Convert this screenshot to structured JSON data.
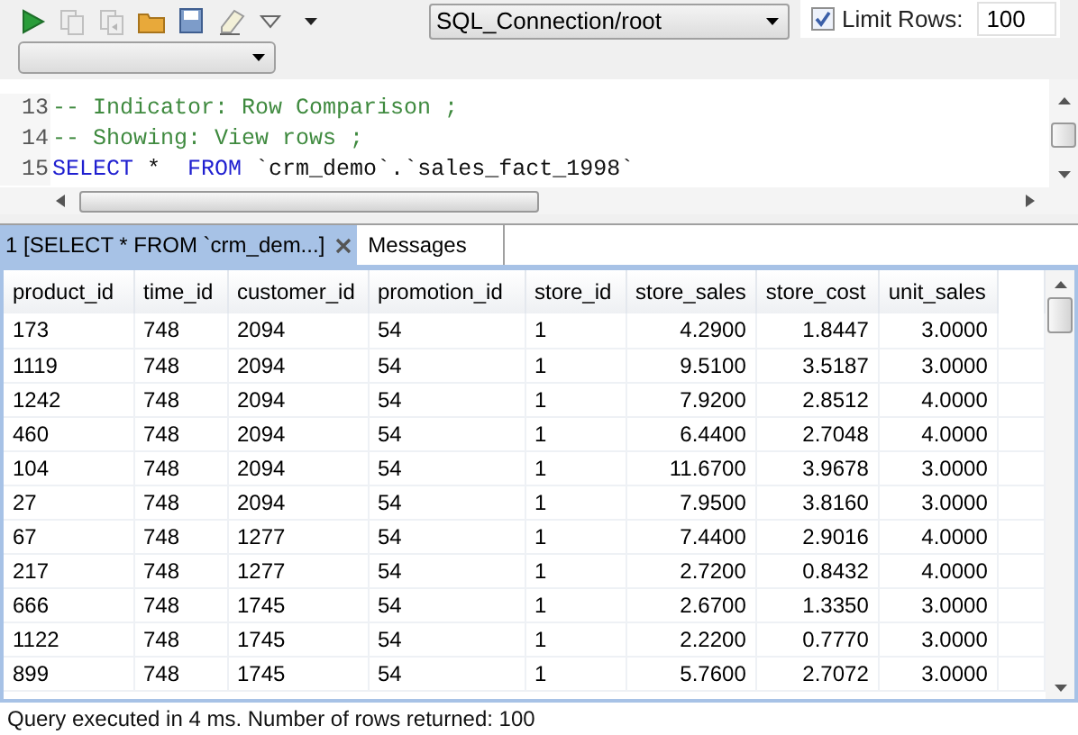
{
  "toolbar": {
    "buttons": [
      {
        "kind": "run",
        "disabled": false
      },
      {
        "kind": "copy",
        "disabled": true
      },
      {
        "kind": "copy-back",
        "disabled": true
      },
      {
        "kind": "open",
        "disabled": false
      },
      {
        "kind": "save",
        "disabled": false
      },
      {
        "kind": "eraser",
        "disabled": false
      },
      {
        "kind": "menu-outline",
        "disabled": false
      },
      {
        "kind": "menu",
        "disabled": false
      }
    ],
    "connection": {
      "value": "SQL_Connection/root"
    },
    "limit_rows": {
      "label": "Limit Rows:",
      "checked": true,
      "value": "100"
    }
  },
  "editor": {
    "lines": [
      {
        "number": "13",
        "segments": [
          {
            "kind": "comment",
            "text": "-- Indicator: Row Comparison ;"
          }
        ]
      },
      {
        "number": "14",
        "segments": [
          {
            "kind": "comment",
            "text": "-- Showing: View rows ;"
          }
        ]
      },
      {
        "number": "15",
        "segments": [
          {
            "kind": "keyword",
            "text": "SELECT"
          },
          {
            "kind": "plain",
            "text": " *  "
          },
          {
            "kind": "keyword",
            "text": "FROM"
          },
          {
            "kind": "plain",
            "text": " `crm_demo`.`sales_fact_1998`"
          }
        ]
      }
    ]
  },
  "tabs": [
    {
      "label": "1 [SELECT * FROM `crm_dem...]",
      "selected": true,
      "closable": true
    },
    {
      "label": "Messages",
      "selected": false,
      "closable": false
    }
  ],
  "table": {
    "columns": [
      {
        "label": "product_id",
        "numeric": false
      },
      {
        "label": "time_id",
        "numeric": false
      },
      {
        "label": "customer_id",
        "numeric": false
      },
      {
        "label": "promotion_id",
        "numeric": false
      },
      {
        "label": "store_id",
        "numeric": false
      },
      {
        "label": "store_sales",
        "numeric": true
      },
      {
        "label": "store_cost",
        "numeric": true
      },
      {
        "label": "unit_sales",
        "numeric": true
      }
    ],
    "rows": [
      [
        "173",
        "748",
        "2094",
        "54",
        "1",
        "4.2900",
        "1.8447",
        "3.0000"
      ],
      [
        "1119",
        "748",
        "2094",
        "54",
        "1",
        "9.5100",
        "3.5187",
        "3.0000"
      ],
      [
        "1242",
        "748",
        "2094",
        "54",
        "1",
        "7.9200",
        "2.8512",
        "4.0000"
      ],
      [
        "460",
        "748",
        "2094",
        "54",
        "1",
        "6.4400",
        "2.7048",
        "4.0000"
      ],
      [
        "104",
        "748",
        "2094",
        "54",
        "1",
        "11.6700",
        "3.9678",
        "3.0000"
      ],
      [
        "27",
        "748",
        "2094",
        "54",
        "1",
        "7.9500",
        "3.8160",
        "3.0000"
      ],
      [
        "67",
        "748",
        "1277",
        "54",
        "1",
        "7.4400",
        "2.9016",
        "4.0000"
      ],
      [
        "217",
        "748",
        "1277",
        "54",
        "1",
        "2.7200",
        "0.8432",
        "4.0000"
      ],
      [
        "666",
        "748",
        "1745",
        "54",
        "1",
        "2.6700",
        "1.3350",
        "3.0000"
      ],
      [
        "1122",
        "748",
        "1745",
        "54",
        "1",
        "2.2200",
        "0.7770",
        "3.0000"
      ],
      [
        "899",
        "748",
        "1745",
        "54",
        "1",
        "5.7600",
        "2.7072",
        "3.0000"
      ]
    ]
  },
  "status_bar": {
    "text": "Query executed in 4 ms.  Number of rows returned: 100"
  }
}
